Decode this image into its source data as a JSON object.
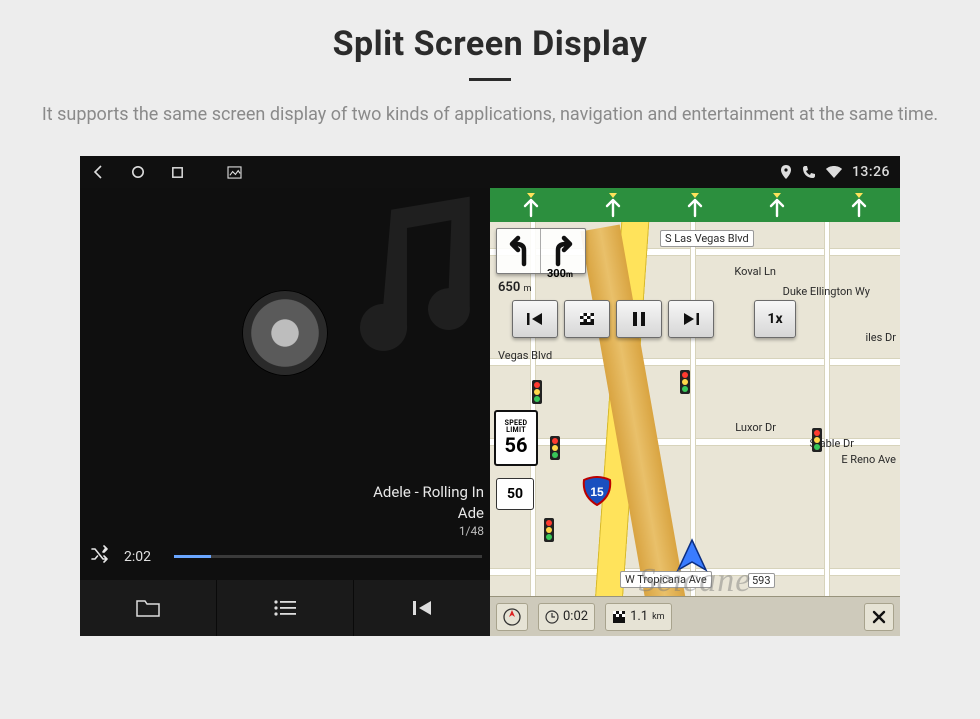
{
  "header": {
    "title": "Split Screen Display",
    "subtitle": "It supports the same screen display of two kinds of applications, navigation and entertainment at the same time."
  },
  "statusbar": {
    "time": "13:26"
  },
  "music": {
    "title_line1": "Adele - Rolling In",
    "title_line2": "Ade",
    "track_index": "1/48",
    "elapsed": "2:02"
  },
  "nav": {
    "lanes_count": 5,
    "turn": {
      "distance": "300",
      "unit": "m"
    },
    "next": {
      "distance": "650",
      "unit": "m"
    },
    "speed": "1x",
    "speed_limit": {
      "label_top": "SPEED",
      "label_bottom": "LIMIT",
      "value": "56"
    },
    "shield": "50",
    "streets": {
      "top": "S Las Vegas Blvd",
      "ne1": "Koval Ln",
      "ne2": "Duke Ellington Wy",
      "mid": "Luxor Dr",
      "mid2": "Stable Dr",
      "east": "E Reno Ave",
      "w1": "Vegas Blvd",
      "bottom": "W Tropicana Ave",
      "bottom_num": "593",
      "fwy": "15",
      "miles": "iles Dr"
    },
    "bottom": {
      "timer": "0:02",
      "remaining": "1.1",
      "remaining_unit": "km"
    }
  },
  "watermark": "Seicane"
}
